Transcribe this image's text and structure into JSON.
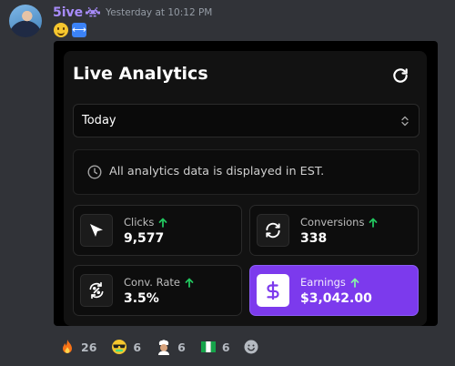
{
  "message": {
    "username": "5ive",
    "bot_icon": "space-invader-icon",
    "timestamp": "Yesterday at 10:12 PM",
    "emojis": [
      "smiling-face-icon",
      "left-right-arrow-icon"
    ]
  },
  "embed": {
    "title": "Live Analytics",
    "refresh_icon": "refresh-icon",
    "period_select": {
      "value": "Today"
    },
    "info_text": "All analytics data is displayed in EST.",
    "stats": [
      {
        "label": "Clicks",
        "value": "9,577",
        "icon": "cursor-icon",
        "trend": "up"
      },
      {
        "label": "Conversions",
        "value": "338",
        "icon": "sync-icon",
        "trend": "up"
      },
      {
        "label": "Conv. Rate",
        "value": "3.5%",
        "icon": "percent-cycle-icon",
        "trend": "up"
      },
      {
        "label": "Earnings",
        "value": "$3,042.00",
        "icon": "dollar-icon",
        "trend": "up"
      }
    ]
  },
  "reactions": [
    {
      "emoji": "fire-icon",
      "count": "26"
    },
    {
      "emoji": "sunglasses-money-face-icon",
      "count": "6"
    },
    {
      "emoji": "chef-icon",
      "count": "6"
    },
    {
      "emoji": "nigeria-flag-icon",
      "count": "6"
    }
  ],
  "colors": {
    "background": "#313338",
    "username": "#a78bfa",
    "accent_purple": "#7c3aed",
    "trend_green": "#22c55e"
  }
}
